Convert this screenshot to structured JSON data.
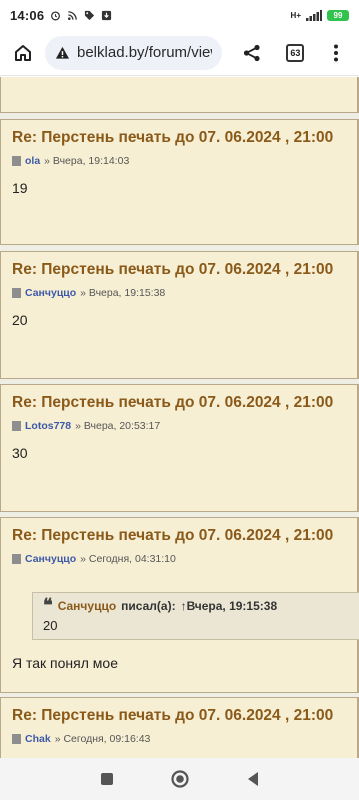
{
  "status": {
    "time": "14:06",
    "network": "H+",
    "battery": "99"
  },
  "browser": {
    "url": "belklad.by/forum/view",
    "tab_count": "63"
  },
  "posts": [
    {
      "title": "Re: Перстень печать до 07. 06.2024 , 21:00",
      "author": "ola",
      "time": "» Вчера, 19:14:03",
      "body": "19"
    },
    {
      "title": "Re: Перстень печать до 07. 06.2024 , 21:00",
      "author": "Санчуццо",
      "time": "» Вчера, 19:15:38",
      "body": "20"
    },
    {
      "title": "Re: Перстень печать до 07. 06.2024 , 21:00",
      "author": "Lotos778",
      "time": "» Вчера, 20:53:17",
      "body": "30"
    },
    {
      "title": "Re: Перстень печать до 07. 06.2024 , 21:00",
      "author": "Санчуццо",
      "time": "» Сегодня, 04:31:10",
      "body": "Я так понял мое",
      "quote": {
        "author": "Санчуццо",
        "wrote": "писал(а):",
        "ref": "↑Вчера, 19:15:38",
        "text": "20"
      }
    },
    {
      "title": "Re: Перстень печать до 07. 06.2024 , 21:00",
      "author": "Chak",
      "time": "» Сегодня, 09:16:43",
      "body": ""
    }
  ],
  "icons": [
    "home-icon",
    "info-icon",
    "share-icon",
    "more-icon",
    "quote-icon",
    "post-doc-icon",
    "recents-icon",
    "home-nav-icon",
    "back-icon"
  ]
}
